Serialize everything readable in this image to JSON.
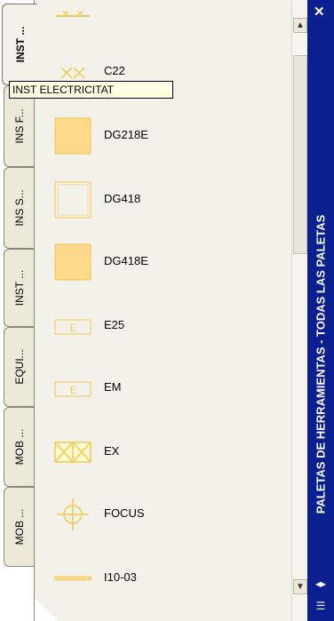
{
  "tabs": [
    {
      "label": "INST ...",
      "active": true
    },
    {
      "label": "INS F...",
      "active": false
    },
    {
      "label": "INS S...",
      "active": false
    },
    {
      "label": "INST ...",
      "active": false
    },
    {
      "label": "EQUI...",
      "active": false
    },
    {
      "label": "MOB ...",
      "active": false
    },
    {
      "label": "MOB ...",
      "active": false
    }
  ],
  "tooltip": "INST ELECTRICITAT",
  "items": [
    {
      "label": "C22",
      "icon": "double-x-icon"
    },
    {
      "label": "DG218E",
      "icon": "filled-square-icon"
    },
    {
      "label": "DG418",
      "icon": "outline-square-icon"
    },
    {
      "label": "DG418E",
      "icon": "filled-square-icon"
    },
    {
      "label": "E25",
      "icon": "e-box-icon",
      "glyph": "E"
    },
    {
      "label": "EM",
      "icon": "e-box-icon",
      "glyph": "E"
    },
    {
      "label": "EX",
      "icon": "double-x-icon"
    },
    {
      "label": "FOCUS",
      "icon": "crosshair-icon"
    },
    {
      "label": "I10-03",
      "icon": "line-icon"
    }
  ],
  "titlebar": {
    "title": "PALETAS DE HERRAMIENTAS - TODAS LAS PALETAS",
    "close_glyph": "✕",
    "collapse_glyph": "◂▸",
    "menu_glyph": "☰"
  },
  "colors": {
    "titlebar_bg": "#0b1f8f",
    "icon_fill": "#fdd98a",
    "icon_stroke": "#f5c850",
    "panel_bg": "#f2f1ea"
  }
}
